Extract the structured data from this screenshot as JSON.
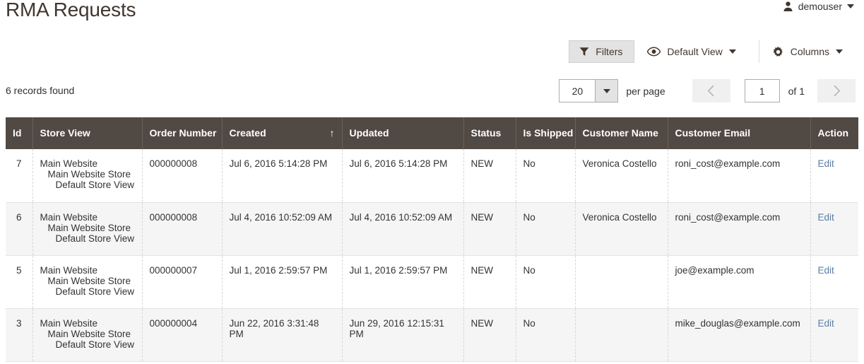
{
  "header": {
    "title": "RMA Requests",
    "user": {
      "name": "demouser",
      "icon": "user-icon",
      "caret": "chevron-down-icon"
    }
  },
  "toolbar": {
    "filters_label": "Filters",
    "view_label": "Default View",
    "columns_label": "Columns"
  },
  "pager": {
    "records_found": "6 records found",
    "per_page_value": "20",
    "per_page_label": "per page",
    "current_page": "1",
    "of_label": "of 1"
  },
  "grid": {
    "columns": [
      {
        "label": "Id",
        "key": "id"
      },
      {
        "label": "Store View",
        "key": "store_view"
      },
      {
        "label": "Order Number",
        "key": "order_number"
      },
      {
        "label": "Created",
        "key": "created",
        "sorted": true,
        "sort_dir": "↑"
      },
      {
        "label": "Updated",
        "key": "updated"
      },
      {
        "label": "Status",
        "key": "status"
      },
      {
        "label": "Is Shipped",
        "key": "is_shipped"
      },
      {
        "label": "Customer Name",
        "key": "customer_name"
      },
      {
        "label": "Customer Email",
        "key": "customer_email"
      },
      {
        "label": "Action",
        "key": "action"
      }
    ],
    "store_view_lines": [
      "Main Website",
      "Main Website Store",
      "Default Store View"
    ],
    "action_label": "Edit",
    "rows": [
      {
        "id": "7",
        "order_number": "000000008",
        "created": "Jul 6, 2016 5:14:28 PM",
        "updated": "Jul 6, 2016 5:14:28 PM",
        "status": "NEW",
        "is_shipped": "No",
        "customer_name": "Veronica Costello",
        "customer_email": "roni_cost@example.com",
        "action": "Edit"
      },
      {
        "id": "6",
        "order_number": "000000008",
        "created": "Jul 4, 2016 10:52:09 AM",
        "updated": "Jul 4, 2016 10:52:09 AM",
        "status": "NEW",
        "is_shipped": "No",
        "customer_name": "Veronica Costello",
        "customer_email": "roni_cost@example.com",
        "action": "Edit"
      },
      {
        "id": "5",
        "order_number": "000000007",
        "created": "Jul 1, 2016 2:59:57 PM",
        "updated": "Jul 1, 2016 2:59:57 PM",
        "status": "NEW",
        "is_shipped": "No",
        "customer_name": "",
        "customer_email": "joe@example.com",
        "action": "Edit"
      },
      {
        "id": "3",
        "order_number": "000000004",
        "created": "Jun 22, 2016 3:31:48 PM",
        "updated": "Jun 29, 2016 12:15:31 PM",
        "status": "NEW",
        "is_shipped": "No",
        "customer_name": "",
        "customer_email": "mike_douglas@example.com",
        "action": "Edit"
      }
    ]
  },
  "colors": {
    "header_bar": "#514943",
    "title_text": "#41362f",
    "link": "#5a7ea6",
    "row_alt": "#f5f5f5",
    "button_face": "#e3e3e3"
  }
}
